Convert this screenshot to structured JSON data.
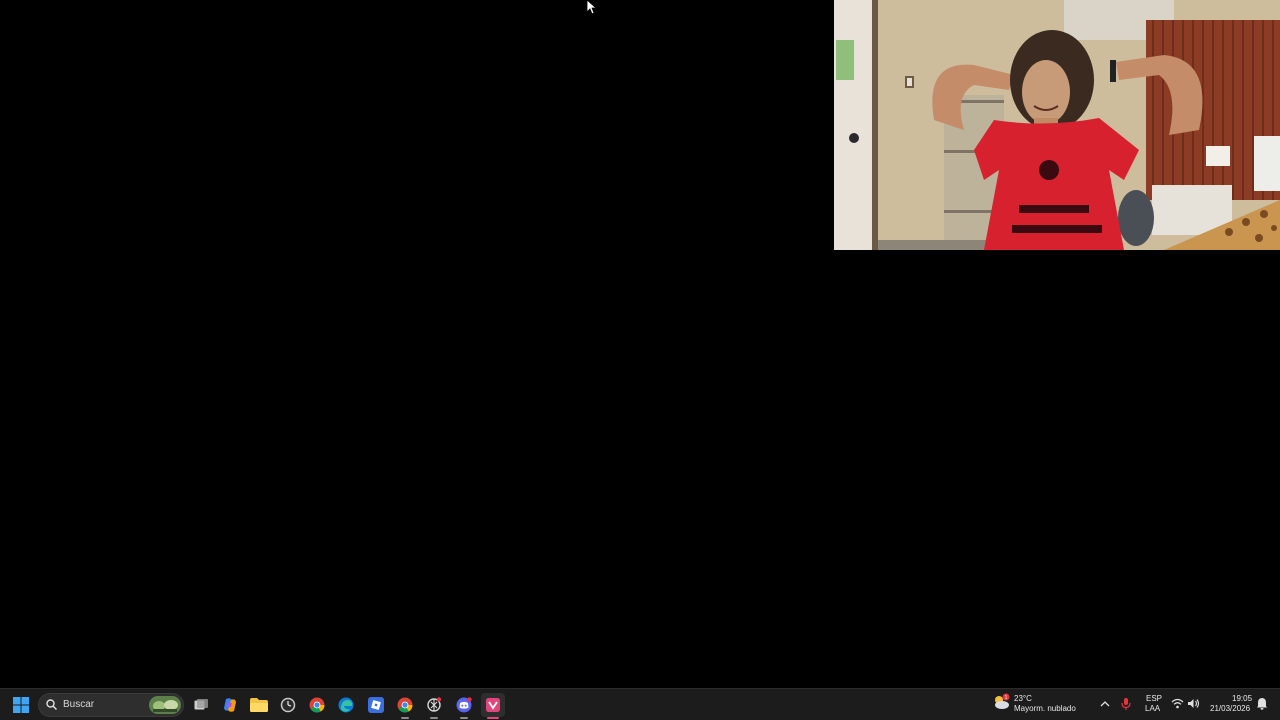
{
  "taskbar": {
    "search_placeholder": "Buscar",
    "pinned_apps": [
      {
        "name": "task-view",
        "icon": "task-view-icon"
      },
      {
        "name": "copilot",
        "icon": "copilot-icon"
      },
      {
        "name": "file-explorer",
        "icon": "folder-icon"
      },
      {
        "name": "clock-app",
        "icon": "clock-icon"
      },
      {
        "name": "chrome",
        "icon": "chrome-icon"
      },
      {
        "name": "edge",
        "icon": "edge-icon"
      },
      {
        "name": "roblox",
        "icon": "roblox-icon"
      },
      {
        "name": "chrome-profile",
        "icon": "chrome-icon"
      },
      {
        "name": "openai",
        "icon": "openai-icon"
      },
      {
        "name": "discord",
        "icon": "discord-icon"
      },
      {
        "name": "recorder",
        "icon": "recorder-icon"
      }
    ]
  },
  "tray": {
    "weather_temp": "23°C",
    "weather_desc": "Mayorm. nublado",
    "weather_badge": "1",
    "language_top": "ESP",
    "language_bottom": "LAA",
    "time": "19:05",
    "date": "21/03/2026"
  },
  "colors": {
    "desktop_bg": "#000000",
    "taskbar_bg": "#1c1c1c",
    "accent": "#e0457b"
  }
}
